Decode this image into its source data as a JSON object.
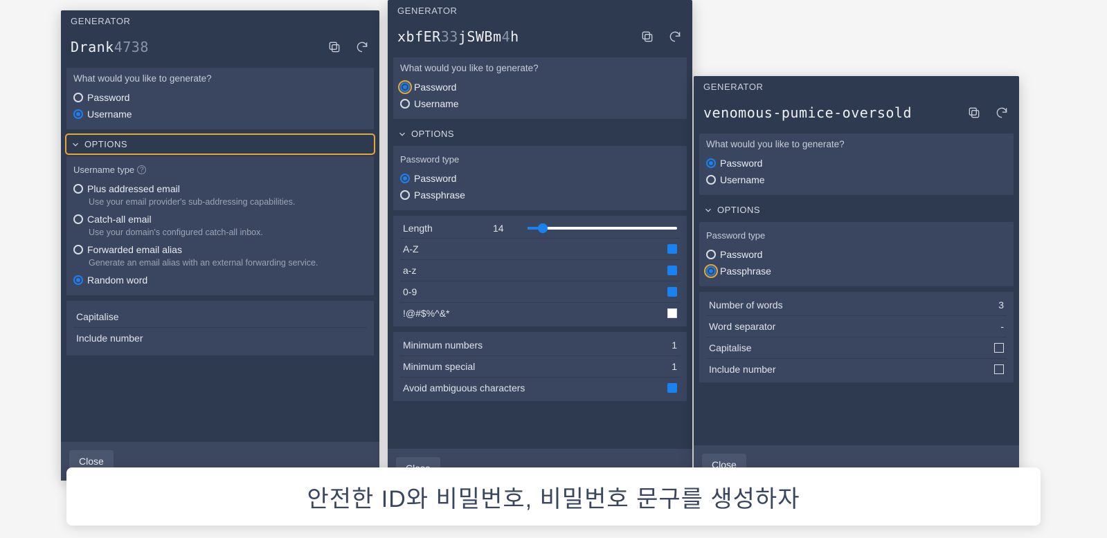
{
  "panel1": {
    "header": "GENERATOR",
    "generated": {
      "bold": "Drank",
      "dim": "4738"
    },
    "question": "What would you like to generate?",
    "radios": {
      "password": "Password",
      "username": "Username"
    },
    "options_label": "OPTIONS",
    "type_label": "Username type",
    "types": [
      {
        "label": "Plus addressed email",
        "desc": "Use your email provider's sub-addressing capabilities."
      },
      {
        "label": "Catch-all email",
        "desc": "Use your domain's configured catch-all inbox."
      },
      {
        "label": "Forwarded email alias",
        "desc": "Generate an email alias with an external forwarding service."
      },
      {
        "label": "Random word",
        "desc": ""
      }
    ],
    "props": {
      "capitalise": "Capitalise",
      "include_number": "Include number"
    },
    "close": "Close"
  },
  "panel2": {
    "header": "GENERATOR",
    "generated": {
      "p1": "xbfER",
      "d1": "33",
      "p2": "jSWBm",
      "d2": "4",
      "p3": "h"
    },
    "question": "What would you like to generate?",
    "radios": {
      "password": "Password",
      "username": "Username"
    },
    "options_label": "OPTIONS",
    "type_label": "Password type",
    "types": {
      "password": "Password",
      "passphrase": "Passphrase"
    },
    "length_label": "Length",
    "length_value": "14",
    "charset": {
      "upper": "A-Z",
      "lower": "a-z",
      "num": "0-9",
      "special": "!@#$%^&*"
    },
    "min_num_label": "Minimum numbers",
    "min_num_value": "1",
    "min_spec_label": "Minimum special",
    "min_spec_value": "1",
    "avoid_label": "Avoid ambiguous characters",
    "close": "Close"
  },
  "panel3": {
    "header": "GENERATOR",
    "generated": "venomous-pumice-oversold",
    "question": "What would you like to generate?",
    "radios": {
      "password": "Password",
      "username": "Username"
    },
    "options_label": "OPTIONS",
    "type_label": "Password type",
    "types": {
      "password": "Password",
      "passphrase": "Passphrase"
    },
    "num_words_label": "Number of words",
    "num_words_value": "3",
    "sep_label": "Word separator",
    "sep_value": "-",
    "capitalise": "Capitalise",
    "include_number": "Include number",
    "close": "Close"
  },
  "caption": "안전한 ID와 비밀번호, 비밀번호 문구를 생성하자"
}
